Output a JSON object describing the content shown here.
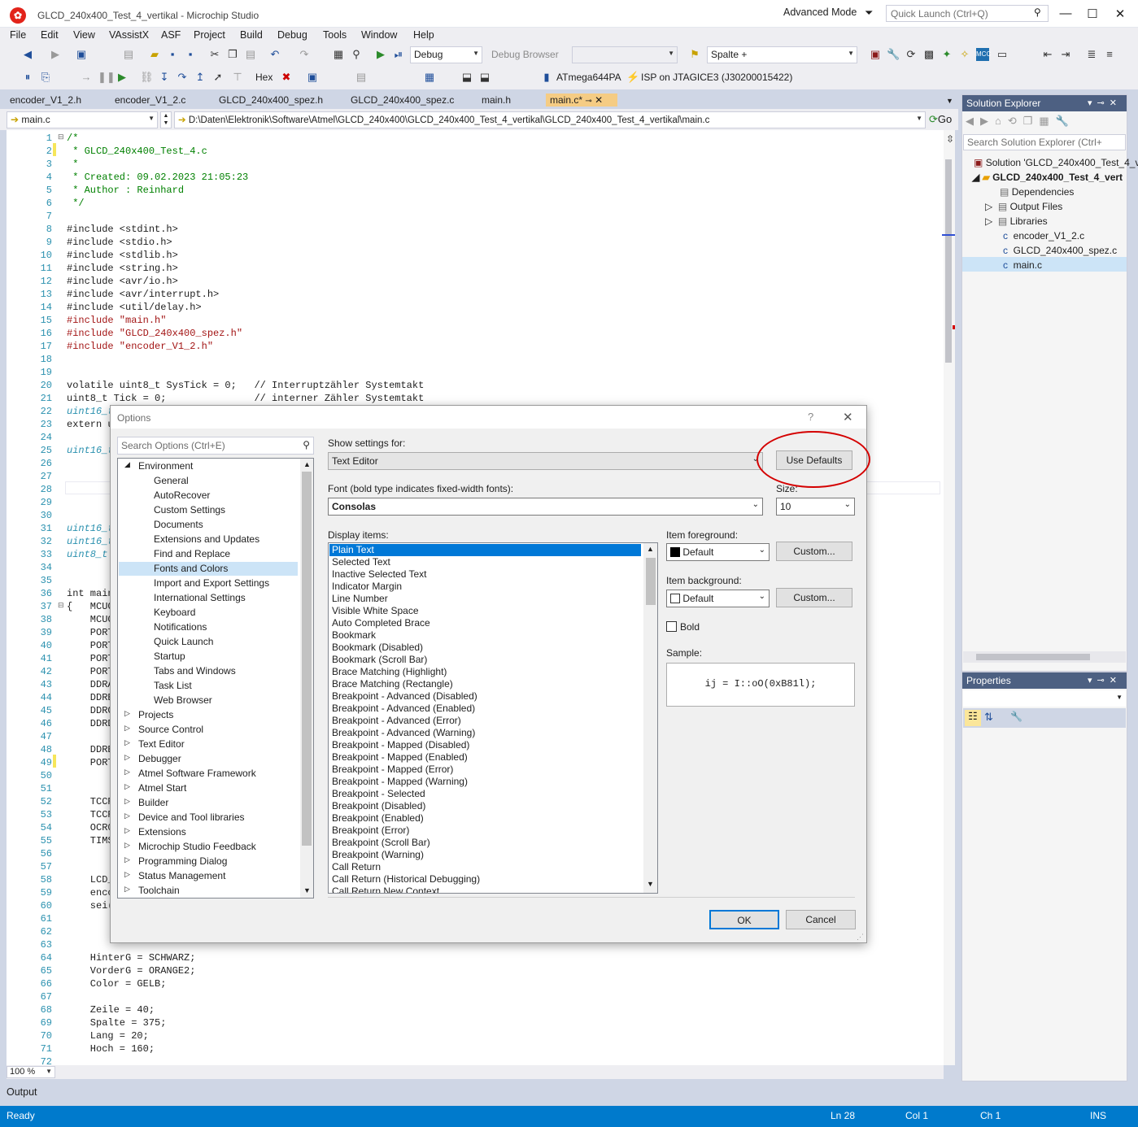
{
  "window": {
    "title": "GLCD_240x400_Test_4_vertikal - Microchip Studio",
    "advanced_mode": "Advanced Mode",
    "quick_launch": "Quick Launch (Ctrl+Q)",
    "minimize": "—",
    "maximize": "☐",
    "close": "✕"
  },
  "menu": [
    "File",
    "Edit",
    "View",
    "VAssistX",
    "ASF",
    "Project",
    "Build",
    "Debug",
    "Tools",
    "Window",
    "Help"
  ],
  "toolbar": {
    "config": "Debug",
    "debug_browser": "Debug Browser",
    "find_combo": "Spalte +",
    "hex": "Hex",
    "device": "ATmega644PA",
    "tool": "ISP on JTAGICE3 (J30200015422)"
  },
  "tabs": [
    "encoder_V1_2.h",
    "encoder_V1_2.c",
    "GLCD_240x400_spez.h",
    "GLCD_240x400_spez.c",
    "main.h",
    "main.c*"
  ],
  "nav": {
    "file": "main.c",
    "path": "D:\\Daten\\Elektronik\\Software\\Atmel\\GLCD_240x400\\GLCD_240x400_Test_4_vertikal\\GLCD_240x400_Test_4_vertikal\\main.c",
    "go": "Go"
  },
  "code": [
    {
      "n": "1",
      "t": "/*",
      "c": "c-green"
    },
    {
      "n": "2",
      "t": " * GLCD_240x400_Test_4.c",
      "c": "c-green"
    },
    {
      "n": "3",
      "t": " *",
      "c": "c-green"
    },
    {
      "n": "4",
      "t": " * Created: 09.02.2023 21:05:23",
      "c": "c-green"
    },
    {
      "n": "5",
      "t": " * Author : Reinhard",
      "c": "c-green"
    },
    {
      "n": "6",
      "t": " */",
      "c": "c-green"
    },
    {
      "n": "7",
      "t": "",
      "c": ""
    },
    {
      "n": "8",
      "t": "#include <stdint.h>",
      "c": ""
    },
    {
      "n": "9",
      "t": "#include <stdio.h>",
      "c": ""
    },
    {
      "n": "10",
      "t": "#include <stdlib.h>",
      "c": ""
    },
    {
      "n": "11",
      "t": "#include <string.h>",
      "c": ""
    },
    {
      "n": "12",
      "t": "#include <avr/io.h>",
      "c": ""
    },
    {
      "n": "13",
      "t": "#include <avr/interrupt.h>",
      "c": ""
    },
    {
      "n": "14",
      "t": "#include <util/delay.h>",
      "c": ""
    },
    {
      "n": "15",
      "t": "#include \"main.h\"",
      "c": "inc"
    },
    {
      "n": "16",
      "t": "#include \"GLCD_240x400_spez.h\"",
      "c": "inc"
    },
    {
      "n": "17",
      "t": "#include \"encoder_V1_2.h\"",
      "c": "inc"
    },
    {
      "n": "18",
      "t": "",
      "c": ""
    },
    {
      "n": "19",
      "t": "",
      "c": ""
    },
    {
      "n": "20",
      "t": "volatile uint8_t SysTick = 0;   // Interruptzähler Systemtakt",
      "c": ""
    },
    {
      "n": "21",
      "t": "uint8_t Tick = 0;               // interner Zähler Systemtakt",
      "c": ""
    },
    {
      "n": "22",
      "t": "uint16_t",
      "c": "c-teal"
    },
    {
      "n": "23",
      "t": "extern u",
      "c": ""
    },
    {
      "n": "24",
      "t": "",
      "c": ""
    },
    {
      "n": "25",
      "t": "uint16_t",
      "c": "c-teal"
    },
    {
      "n": "26",
      "t": "",
      "c": ""
    },
    {
      "n": "27",
      "t": "",
      "c": ""
    },
    {
      "n": "28",
      "t": "",
      "c": ""
    },
    {
      "n": "29",
      "t": "",
      "c": ""
    },
    {
      "n": "30",
      "t": "",
      "c": ""
    },
    {
      "n": "31",
      "t": "uint16_t",
      "c": "c-teal"
    },
    {
      "n": "32",
      "t": "uint16_t",
      "c": "c-teal"
    },
    {
      "n": "33",
      "t": "uint8_t",
      "c": "c-teal"
    },
    {
      "n": "34",
      "t": "",
      "c": ""
    },
    {
      "n": "35",
      "t": "",
      "c": ""
    },
    {
      "n": "36",
      "t": "int main",
      "c": ""
    },
    {
      "n": "37",
      "t": "{   MCUC",
      "c": ""
    },
    {
      "n": "38",
      "t": "    MCUC",
      "c": ""
    },
    {
      "n": "39",
      "t": "    PORT",
      "c": ""
    },
    {
      "n": "40",
      "t": "    PORT",
      "c": ""
    },
    {
      "n": "41",
      "t": "    PORT",
      "c": ""
    },
    {
      "n": "42",
      "t": "    PORT",
      "c": ""
    },
    {
      "n": "43",
      "t": "    DDRA",
      "c": ""
    },
    {
      "n": "44",
      "t": "    DDRB",
      "c": ""
    },
    {
      "n": "45",
      "t": "    DDRC",
      "c": ""
    },
    {
      "n": "46",
      "t": "    DDRD",
      "c": ""
    },
    {
      "n": "47",
      "t": "",
      "c": ""
    },
    {
      "n": "48",
      "t": "    DDRB",
      "c": ""
    },
    {
      "n": "49",
      "t": "    PORT",
      "c": ""
    },
    {
      "n": "50",
      "t": "",
      "c": ""
    },
    {
      "n": "51",
      "t": "",
      "c": ""
    },
    {
      "n": "52",
      "t": "    TCCR",
      "c": ""
    },
    {
      "n": "53",
      "t": "    TCCR",
      "c": ""
    },
    {
      "n": "54",
      "t": "    OCR0",
      "c": ""
    },
    {
      "n": "55",
      "t": "    TIMS",
      "c": ""
    },
    {
      "n": "56",
      "t": "",
      "c": ""
    },
    {
      "n": "57",
      "t": "",
      "c": ""
    },
    {
      "n": "58",
      "t": "    LCD_",
      "c": ""
    },
    {
      "n": "59",
      "t": "    enco",
      "c": ""
    },
    {
      "n": "60",
      "t": "    sei(",
      "c": ""
    },
    {
      "n": "61",
      "t": "",
      "c": ""
    },
    {
      "n": "62",
      "t": "",
      "c": ""
    },
    {
      "n": "63",
      "t": "",
      "c": ""
    },
    {
      "n": "64",
      "t": "    HinterG = SCHWARZ;",
      "c": ""
    },
    {
      "n": "65",
      "t": "    VorderG = ORANGE2;",
      "c": ""
    },
    {
      "n": "66",
      "t": "    Color = GELB;",
      "c": ""
    },
    {
      "n": "67",
      "t": "",
      "c": ""
    },
    {
      "n": "68",
      "t": "    Zeile = 40;",
      "c": ""
    },
    {
      "n": "69",
      "t": "    Spalte = 375;",
      "c": ""
    },
    {
      "n": "70",
      "t": "    Lang = 20;",
      "c": ""
    },
    {
      "n": "71",
      "t": "    Hoch = 160;",
      "c": ""
    },
    {
      "n": "72",
      "t": "",
      "c": ""
    }
  ],
  "zoom": "100 %",
  "output_label": "Output",
  "status": {
    "ready": "Ready",
    "ln": "Ln 28",
    "col": "Col 1",
    "ch": "Ch 1",
    "ins": "INS"
  },
  "solution_explorer": {
    "title": "Solution Explorer",
    "search": "Search Solution Explorer (Ctrl+",
    "items": [
      "Solution 'GLCD_240x400_Test_4_v",
      "GLCD_240x400_Test_4_vert",
      "Dependencies",
      "Output Files",
      "Libraries",
      "encoder_V1_2.c",
      "GLCD_240x400_spez.c",
      "main.c"
    ]
  },
  "properties": {
    "title": "Properties"
  },
  "dialog": {
    "title": "Options",
    "help": "?",
    "close": "✕",
    "search_placeholder": "Search Options (Ctrl+E)",
    "tree": [
      {
        "label": "Environment",
        "level": 0,
        "exp": "◢"
      },
      {
        "label": "General",
        "level": 1
      },
      {
        "label": "AutoRecover",
        "level": 1
      },
      {
        "label": "Custom Settings",
        "level": 1
      },
      {
        "label": "Documents",
        "level": 1
      },
      {
        "label": "Extensions and Updates",
        "level": 1
      },
      {
        "label": "Find and Replace",
        "level": 1
      },
      {
        "label": "Fonts and Colors",
        "level": 1,
        "sel": true
      },
      {
        "label": "Import and Export Settings",
        "level": 1
      },
      {
        "label": "International Settings",
        "level": 1
      },
      {
        "label": "Keyboard",
        "level": 1
      },
      {
        "label": "Notifications",
        "level": 1
      },
      {
        "label": "Quick Launch",
        "level": 1
      },
      {
        "label": "Startup",
        "level": 1
      },
      {
        "label": "Tabs and Windows",
        "level": 1
      },
      {
        "label": "Task List",
        "level": 1
      },
      {
        "label": "Web Browser",
        "level": 1
      },
      {
        "label": "Projects",
        "level": 0,
        "exp": "▷"
      },
      {
        "label": "Source Control",
        "level": 0,
        "exp": "▷"
      },
      {
        "label": "Text Editor",
        "level": 0,
        "exp": "▷"
      },
      {
        "label": "Debugger",
        "level": 0,
        "exp": "▷"
      },
      {
        "label": "Atmel Software Framework",
        "level": 0,
        "exp": "▷"
      },
      {
        "label": "Atmel Start",
        "level": 0,
        "exp": "▷"
      },
      {
        "label": "Builder",
        "level": 0,
        "exp": "▷"
      },
      {
        "label": "Device and Tool libraries",
        "level": 0,
        "exp": "▷"
      },
      {
        "label": "Extensions",
        "level": 0,
        "exp": "▷"
      },
      {
        "label": "Microchip Studio Feedback",
        "level": 0,
        "exp": "▷"
      },
      {
        "label": "Programming Dialog",
        "level": 0,
        "exp": "▷"
      },
      {
        "label": "Status Management",
        "level": 0,
        "exp": "▷"
      },
      {
        "label": "Toolchain",
        "level": 0,
        "exp": "▷"
      }
    ],
    "show_settings_label": "Show settings for:",
    "show_settings_value": "Text Editor",
    "use_defaults": "Use Defaults",
    "font_label": "Font (bold type indicates fixed-width fonts):",
    "font_value": "Consolas",
    "size_label": "Size:",
    "size_value": "10",
    "display_items_label": "Display items:",
    "display_items": [
      "Plain Text",
      "Selected Text",
      "Inactive Selected Text",
      "Indicator Margin",
      "Line Number",
      "Visible White Space",
      "Auto Completed Brace",
      "Bookmark",
      "Bookmark (Disabled)",
      "Bookmark (Scroll Bar)",
      "Brace Matching (Highlight)",
      "Brace Matching (Rectangle)",
      "Breakpoint - Advanced (Disabled)",
      "Breakpoint - Advanced (Enabled)",
      "Breakpoint - Advanced (Error)",
      "Breakpoint - Advanced (Warning)",
      "Breakpoint - Mapped (Disabled)",
      "Breakpoint - Mapped (Enabled)",
      "Breakpoint - Mapped (Error)",
      "Breakpoint - Mapped (Warning)",
      "Breakpoint - Selected",
      "Breakpoint (Disabled)",
      "Breakpoint (Enabled)",
      "Breakpoint (Error)",
      "Breakpoint (Scroll Bar)",
      "Breakpoint (Warning)",
      "Call Return",
      "Call Return (Historical Debugging)",
      "Call Return New Context"
    ],
    "fg_label": "Item foreground:",
    "fg_value": "Default",
    "bg_label": "Item background:",
    "bg_value": "Default",
    "custom": "Custom...",
    "bold_label": "Bold",
    "sample_label": "Sample:",
    "sample_text": "ij = I::oO(0xB81l);",
    "ok": "OK",
    "cancel": "Cancel"
  }
}
